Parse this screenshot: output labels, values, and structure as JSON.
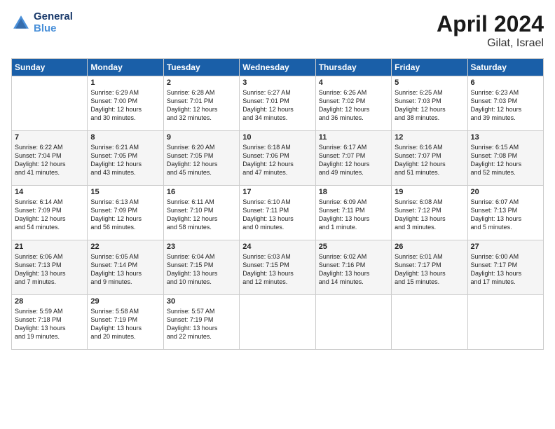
{
  "header": {
    "logo_line1": "General",
    "logo_line2": "Blue",
    "title": "April 2024",
    "subtitle": "Gilat, Israel"
  },
  "days_of_week": [
    "Sunday",
    "Monday",
    "Tuesday",
    "Wednesday",
    "Thursday",
    "Friday",
    "Saturday"
  ],
  "weeks": [
    [
      {
        "day": "",
        "sunrise": "",
        "sunset": "",
        "daylight": ""
      },
      {
        "day": "1",
        "sunrise": "Sunrise: 6:29 AM",
        "sunset": "Sunset: 7:00 PM",
        "daylight": "Daylight: 12 hours and 30 minutes."
      },
      {
        "day": "2",
        "sunrise": "Sunrise: 6:28 AM",
        "sunset": "Sunset: 7:01 PM",
        "daylight": "Daylight: 12 hours and 32 minutes."
      },
      {
        "day": "3",
        "sunrise": "Sunrise: 6:27 AM",
        "sunset": "Sunset: 7:01 PM",
        "daylight": "Daylight: 12 hours and 34 minutes."
      },
      {
        "day": "4",
        "sunrise": "Sunrise: 6:26 AM",
        "sunset": "Sunset: 7:02 PM",
        "daylight": "Daylight: 12 hours and 36 minutes."
      },
      {
        "day": "5",
        "sunrise": "Sunrise: 6:25 AM",
        "sunset": "Sunset: 7:03 PM",
        "daylight": "Daylight: 12 hours and 38 minutes."
      },
      {
        "day": "6",
        "sunrise": "Sunrise: 6:23 AM",
        "sunset": "Sunset: 7:03 PM",
        "daylight": "Daylight: 12 hours and 39 minutes."
      }
    ],
    [
      {
        "day": "7",
        "sunrise": "Sunrise: 6:22 AM",
        "sunset": "Sunset: 7:04 PM",
        "daylight": "Daylight: 12 hours and 41 minutes."
      },
      {
        "day": "8",
        "sunrise": "Sunrise: 6:21 AM",
        "sunset": "Sunset: 7:05 PM",
        "daylight": "Daylight: 12 hours and 43 minutes."
      },
      {
        "day": "9",
        "sunrise": "Sunrise: 6:20 AM",
        "sunset": "Sunset: 7:05 PM",
        "daylight": "Daylight: 12 hours and 45 minutes."
      },
      {
        "day": "10",
        "sunrise": "Sunrise: 6:18 AM",
        "sunset": "Sunset: 7:06 PM",
        "daylight": "Daylight: 12 hours and 47 minutes."
      },
      {
        "day": "11",
        "sunrise": "Sunrise: 6:17 AM",
        "sunset": "Sunset: 7:07 PM",
        "daylight": "Daylight: 12 hours and 49 minutes."
      },
      {
        "day": "12",
        "sunrise": "Sunrise: 6:16 AM",
        "sunset": "Sunset: 7:07 PM",
        "daylight": "Daylight: 12 hours and 51 minutes."
      },
      {
        "day": "13",
        "sunrise": "Sunrise: 6:15 AM",
        "sunset": "Sunset: 7:08 PM",
        "daylight": "Daylight: 12 hours and 52 minutes."
      }
    ],
    [
      {
        "day": "14",
        "sunrise": "Sunrise: 6:14 AM",
        "sunset": "Sunset: 7:09 PM",
        "daylight": "Daylight: 12 hours and 54 minutes."
      },
      {
        "day": "15",
        "sunrise": "Sunrise: 6:13 AM",
        "sunset": "Sunset: 7:09 PM",
        "daylight": "Daylight: 12 hours and 56 minutes."
      },
      {
        "day": "16",
        "sunrise": "Sunrise: 6:11 AM",
        "sunset": "Sunset: 7:10 PM",
        "daylight": "Daylight: 12 hours and 58 minutes."
      },
      {
        "day": "17",
        "sunrise": "Sunrise: 6:10 AM",
        "sunset": "Sunset: 7:11 PM",
        "daylight": "Daylight: 13 hours and 0 minutes."
      },
      {
        "day": "18",
        "sunrise": "Sunrise: 6:09 AM",
        "sunset": "Sunset: 7:11 PM",
        "daylight": "Daylight: 13 hours and 1 minute."
      },
      {
        "day": "19",
        "sunrise": "Sunrise: 6:08 AM",
        "sunset": "Sunset: 7:12 PM",
        "daylight": "Daylight: 13 hours and 3 minutes."
      },
      {
        "day": "20",
        "sunrise": "Sunrise: 6:07 AM",
        "sunset": "Sunset: 7:13 PM",
        "daylight": "Daylight: 13 hours and 5 minutes."
      }
    ],
    [
      {
        "day": "21",
        "sunrise": "Sunrise: 6:06 AM",
        "sunset": "Sunset: 7:13 PM",
        "daylight": "Daylight: 13 hours and 7 minutes."
      },
      {
        "day": "22",
        "sunrise": "Sunrise: 6:05 AM",
        "sunset": "Sunset: 7:14 PM",
        "daylight": "Daylight: 13 hours and 9 minutes."
      },
      {
        "day": "23",
        "sunrise": "Sunrise: 6:04 AM",
        "sunset": "Sunset: 7:15 PM",
        "daylight": "Daylight: 13 hours and 10 minutes."
      },
      {
        "day": "24",
        "sunrise": "Sunrise: 6:03 AM",
        "sunset": "Sunset: 7:15 PM",
        "daylight": "Daylight: 13 hours and 12 minutes."
      },
      {
        "day": "25",
        "sunrise": "Sunrise: 6:02 AM",
        "sunset": "Sunset: 7:16 PM",
        "daylight": "Daylight: 13 hours and 14 minutes."
      },
      {
        "day": "26",
        "sunrise": "Sunrise: 6:01 AM",
        "sunset": "Sunset: 7:17 PM",
        "daylight": "Daylight: 13 hours and 15 minutes."
      },
      {
        "day": "27",
        "sunrise": "Sunrise: 6:00 AM",
        "sunset": "Sunset: 7:17 PM",
        "daylight": "Daylight: 13 hours and 17 minutes."
      }
    ],
    [
      {
        "day": "28",
        "sunrise": "Sunrise: 5:59 AM",
        "sunset": "Sunset: 7:18 PM",
        "daylight": "Daylight: 13 hours and 19 minutes."
      },
      {
        "day": "29",
        "sunrise": "Sunrise: 5:58 AM",
        "sunset": "Sunset: 7:19 PM",
        "daylight": "Daylight: 13 hours and 20 minutes."
      },
      {
        "day": "30",
        "sunrise": "Sunrise: 5:57 AM",
        "sunset": "Sunset: 7:19 PM",
        "daylight": "Daylight: 13 hours and 22 minutes."
      },
      {
        "day": "",
        "sunrise": "",
        "sunset": "",
        "daylight": ""
      },
      {
        "day": "",
        "sunrise": "",
        "sunset": "",
        "daylight": ""
      },
      {
        "day": "",
        "sunrise": "",
        "sunset": "",
        "daylight": ""
      },
      {
        "day": "",
        "sunrise": "",
        "sunset": "",
        "daylight": ""
      }
    ]
  ]
}
